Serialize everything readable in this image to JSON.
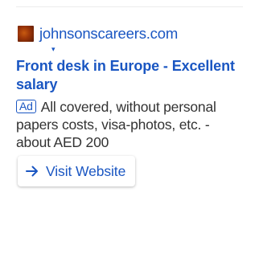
{
  "ad": {
    "domain": "johnsonscareers.com",
    "caret": "▾",
    "headline": "Front desk in Europe - Excellent salary",
    "badge": "Ad",
    "description": "All covered, without personal papers costs, visa-photos, etc. - about AED 200",
    "cta_label": "Visit Website"
  },
  "icons": {
    "favicon": "site-favicon-icon",
    "cta": "arrow-right-icon"
  },
  "colors": {
    "link": "#1a56c2",
    "text": "#333333",
    "background": "#ffffff",
    "divider": "#ececec"
  }
}
